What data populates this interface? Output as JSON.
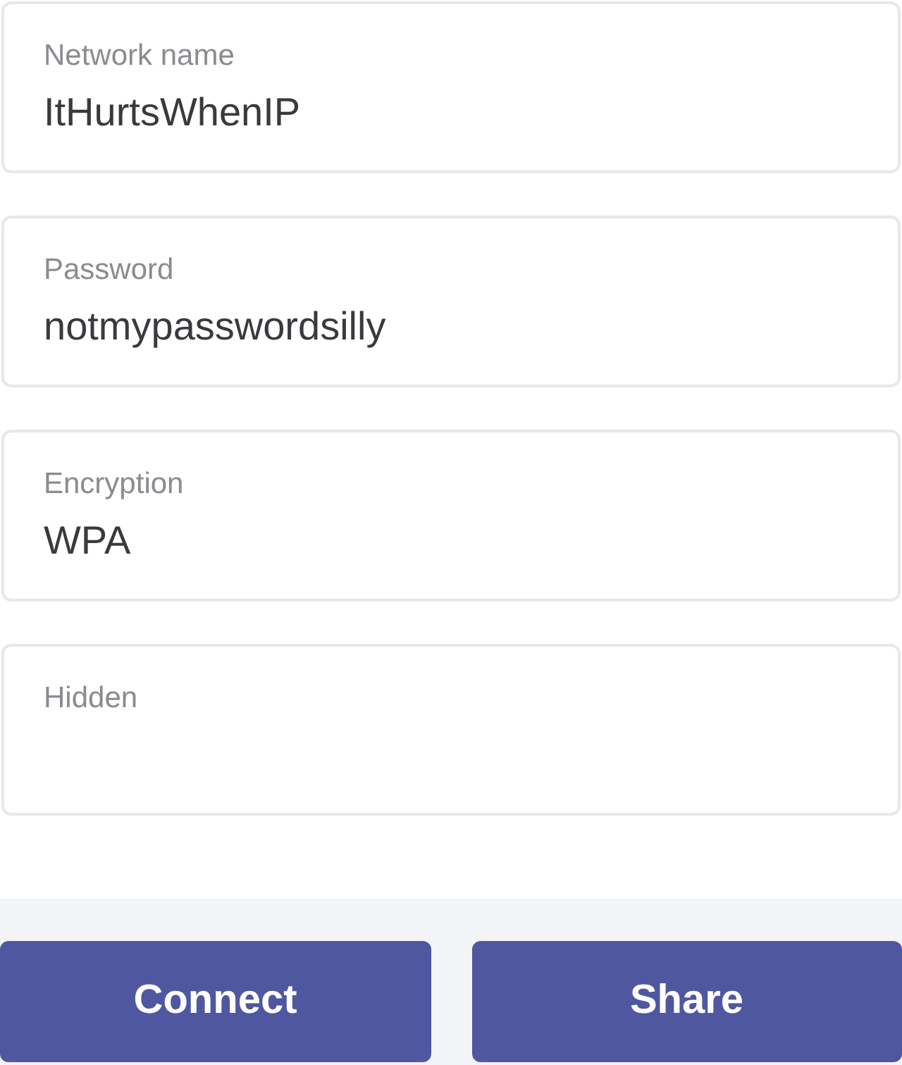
{
  "fields": [
    {
      "label": "Network name",
      "value": "ItHurtsWhenIP"
    },
    {
      "label": "Password",
      "value": "notmypasswordsilly"
    },
    {
      "label": "Encryption",
      "value": "WPA"
    },
    {
      "label": "Hidden"
    }
  ],
  "buttons": [
    "Connect",
    "Share"
  ]
}
